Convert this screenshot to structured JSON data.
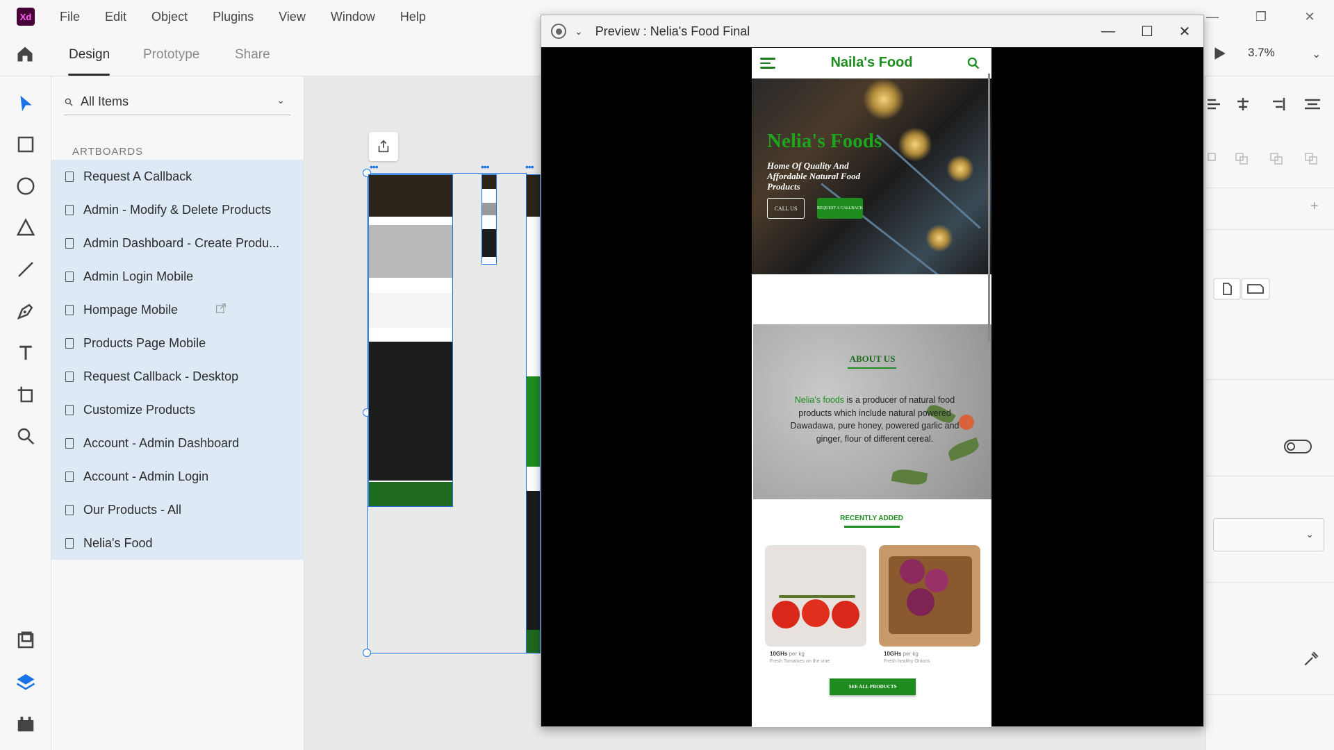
{
  "app": {
    "logo": "Xd"
  },
  "menu": [
    "File",
    "Edit",
    "Object",
    "Plugins",
    "View",
    "Window",
    "Help"
  ],
  "modes": {
    "design": "Design",
    "prototype": "Prototype",
    "share": "Share"
  },
  "zoom": "3.7%",
  "layers": {
    "filter": "All Items",
    "section": "ARTBOARDS",
    "items": [
      "Request A Callback",
      "Admin - Modify & Delete Products",
      "Admin Dashboard - Create Produ...",
      "Admin Login Mobile",
      "Hompage Mobile",
      "Products Page Mobile",
      "Request Callback - Desktop",
      "Customize Products",
      "Account - Admin Dashboard",
      "Account - Admin Login",
      "Our Products - All",
      "Nelia's Food"
    ]
  },
  "preview": {
    "title": "Preview : Nelia's Food Final",
    "site": {
      "brand": "Naila's Food",
      "hero_title": "Nelia's Foods",
      "hero_subtitle": "Home Of Quality And Affordable Natural Food Products",
      "call_btn": "CALL US",
      "callback_btn": "REQUEST A CALLBACK",
      "about_title": "ABOUT US",
      "about_highlight": "Nelia's foods",
      "about_text": " is a producer of natural food products which include natural powered Dawadawa, pure honey, powered garlic and ginger, flour of different cereal.",
      "recent_title": "RECENTLY ADDED",
      "products": [
        {
          "price": "10GHs",
          "unit": "per kg",
          "desc": "Fresh Tomatoes on the vine"
        },
        {
          "price": "10GHs",
          "unit": "per kg",
          "desc": "Fresh healthy Onions"
        }
      ],
      "see_all": "SEE ALL PRODUCTS"
    }
  },
  "colors": {
    "brand_green": "#1e8c1e",
    "selection_blue": "#1b73e8",
    "xd_purple": "#470137"
  }
}
